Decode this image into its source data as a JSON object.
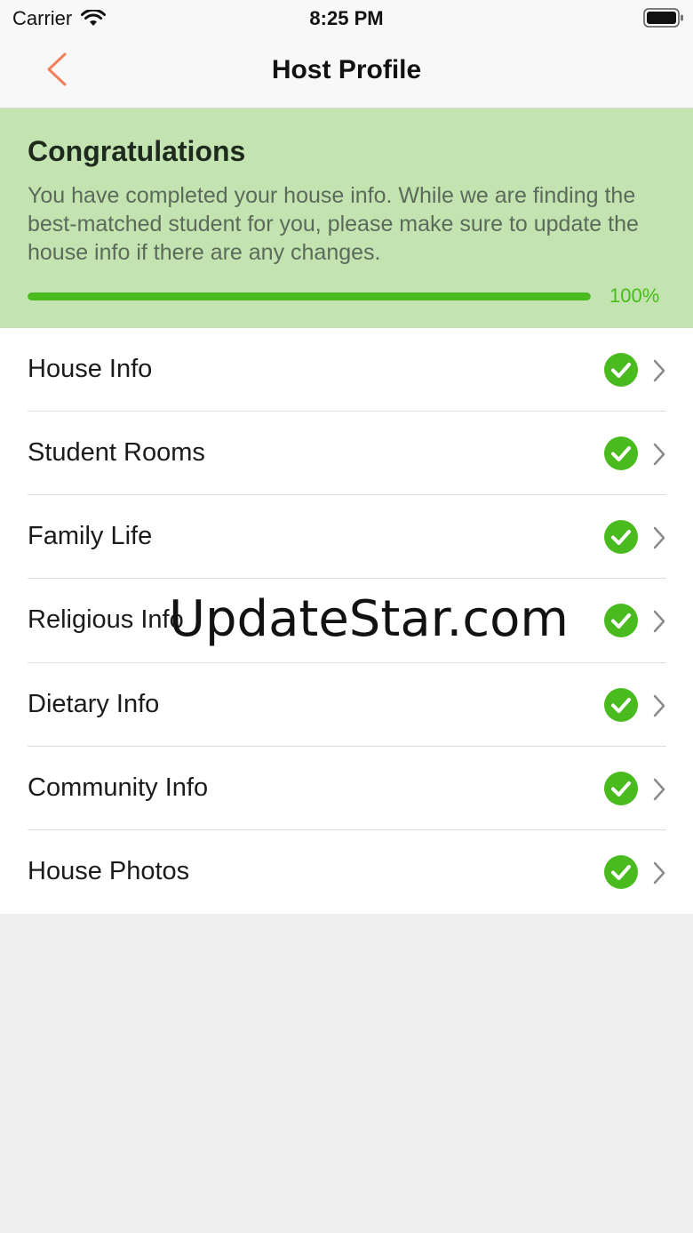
{
  "status_bar": {
    "carrier": "Carrier",
    "time": "8:25 PM",
    "wifi_icon": "wifi-icon",
    "battery_icon": "battery-icon"
  },
  "nav": {
    "title": "Host Profile",
    "back_icon": "chevron-left-icon",
    "back_color": "#f0805c"
  },
  "banner": {
    "title": "Congratulations",
    "message": "You have completed your house info. While we are finding the best-matched student for you, please make sure to update the house info if there are any changes.",
    "progress_text": "100%",
    "progress_value": 1.0,
    "background": "#c3e4b0",
    "accent": "#49bb1e"
  },
  "sections": [
    {
      "label": "House Info",
      "status_icon": "check-circle-icon",
      "chevron": "chevron-right-icon"
    },
    {
      "label": "Student Rooms",
      "status_icon": "check-circle-icon",
      "chevron": "chevron-right-icon"
    },
    {
      "label": "Family Life",
      "status_icon": "check-circle-icon",
      "chevron": "chevron-right-icon"
    },
    {
      "label": "Religious Info",
      "status_icon": "check-circle-icon",
      "chevron": "chevron-right-icon"
    },
    {
      "label": "Dietary Info",
      "status_icon": "check-circle-icon",
      "chevron": "chevron-right-icon"
    },
    {
      "label": "Community Info",
      "status_icon": "check-circle-icon",
      "chevron": "chevron-right-icon"
    },
    {
      "label": "House Photos",
      "status_icon": "check-circle-icon",
      "chevron": "chevron-right-icon"
    }
  ],
  "watermark": "UpdateStar.com"
}
